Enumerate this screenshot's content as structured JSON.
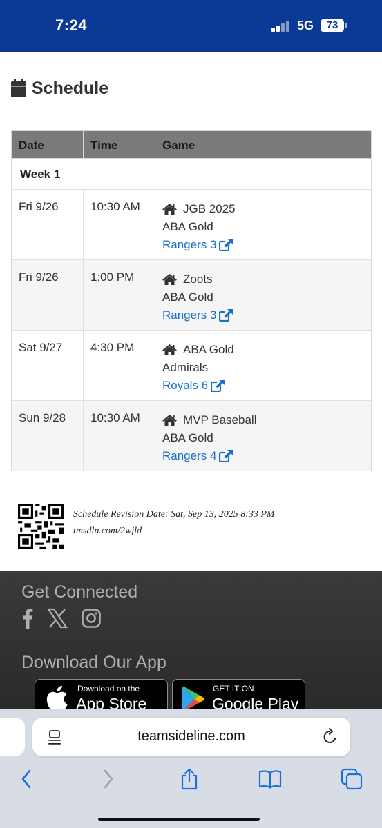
{
  "status_bar": {
    "time": "7:24",
    "network": "5G",
    "battery": "73"
  },
  "page": {
    "title": "Schedule"
  },
  "table": {
    "headers": [
      "Date",
      "Time",
      "Game"
    ],
    "week_label": "Week 1",
    "rows": [
      {
        "date": "Fri 9/26",
        "time": "10:30 AM",
        "home": "JGB 2025",
        "away": "ABA Gold",
        "score": "Rangers 3"
      },
      {
        "date": "Fri 9/26",
        "time": "1:00 PM",
        "home": "Zoots",
        "away": "ABA Gold",
        "score": "Rangers 3"
      },
      {
        "date": "Sat 9/27",
        "time": "4:30 PM",
        "home": "ABA Gold",
        "away": "Admirals",
        "score": "Royals 6"
      },
      {
        "date": "Sun 9/28",
        "time": "10:30 AM",
        "home": "MVP Baseball",
        "away": "ABA Gold",
        "score": "Rangers 4"
      }
    ]
  },
  "revision": {
    "text": "Schedule Revision Date: Sat, Sep 13, 2025 8:33 PM",
    "short_url": "tmsdln.com/2wjld"
  },
  "footer": {
    "connected_heading": "Get Connected",
    "social_icons": [
      "facebook-icon",
      "x-icon",
      "instagram-icon"
    ],
    "app_heading": "Download Our App",
    "app_store": {
      "small": "Download on the",
      "big": "App Store"
    },
    "google_play": {
      "small": "GET IT ON",
      "big": "Google Play"
    }
  },
  "browser": {
    "url": "teamsideline.com"
  },
  "colors": {
    "header_blue": "#0b3a96",
    "link_blue": "#1a6fc9",
    "table_header": "#7a7a7a",
    "footer_bg": "#333333"
  }
}
